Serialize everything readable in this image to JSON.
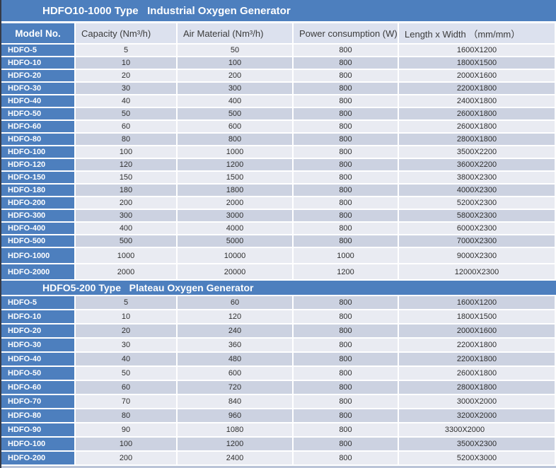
{
  "table": {
    "columns": [
      "Model No.",
      "Capacity (Nm³/h)",
      "Air Material (Nm³/h)",
      "Power consumption (W)",
      "Length x Width （mm/mm）"
    ]
  },
  "sections": [
    {
      "title": "HDFO10-1000 Type   Industrial Oxygen Generator",
      "rows": [
        [
          "HDFO-5",
          "5",
          "50",
          "800",
          "1600X1200"
        ],
        [
          "HDFO-10",
          "10",
          "100",
          "800",
          "1800X1500"
        ],
        [
          "HDFO-20",
          "20",
          "200",
          "800",
          "2000X1600"
        ],
        [
          "HDFO-30",
          "30",
          "300",
          "800",
          "2200X1800"
        ],
        [
          "HDFO-40",
          "40",
          "400",
          "800",
          "2400X1800"
        ],
        [
          "HDFO-50",
          "50",
          "500",
          "800",
          "2600X1800"
        ],
        [
          "HDFO-60",
          "60",
          "600",
          "800",
          "2600X1800"
        ],
        [
          "HDFO-80",
          "80",
          "800",
          "800",
          "2800X1800"
        ],
        [
          "HDFO-100",
          "100",
          "1000",
          "800",
          "3500X2200"
        ],
        [
          "HDFO-120",
          "120",
          "1200",
          "800",
          "3600X2200"
        ],
        [
          "HDFO-150",
          "150",
          "1500",
          "800",
          "3800X2300"
        ],
        [
          "HDFO-180",
          "180",
          "1800",
          "800",
          "4000X2300"
        ],
        [
          "HDFO-200",
          "200",
          "2000",
          "800",
          "5200X2300"
        ],
        [
          "HDFO-300",
          "300",
          "3000",
          "800",
          "5800X2300"
        ],
        [
          "HDFO-400",
          "400",
          "4000",
          "800",
          "6000X2300"
        ],
        [
          "HDFO-500",
          "500",
          "5000",
          "800",
          "7000X2300"
        ],
        [
          "HDFO-1000",
          "1000",
          "10000",
          "1000",
          "9000X2300"
        ],
        [
          "HDFO-2000",
          "2000",
          "20000",
          "1200",
          "12000X2300"
        ]
      ]
    },
    {
      "title": "HDFO5-200 Type   Plateau Oxygen Generator",
      "rows": [
        [
          "HDFO-5",
          "5",
          "60",
          "800",
          "1600X1200"
        ],
        [
          "HDFO-10",
          "10",
          "120",
          "800",
          "1800X1500"
        ],
        [
          "HDFO-20",
          "20",
          "240",
          "800",
          "2000X1600"
        ],
        [
          "HDFO-30",
          "30",
          "360",
          "800",
          "2200X1800"
        ],
        [
          "HDFO-40",
          "40",
          "480",
          "800",
          "2200X1800"
        ],
        [
          "HDFO-50",
          "50",
          "600",
          "800",
          "2600X1800"
        ],
        [
          "HDFO-60",
          "60",
          "720",
          "800",
          "2800X1800"
        ],
        [
          "HDFO-70",
          "70",
          "840",
          "800",
          "3000X2000"
        ],
        [
          "HDFO-80",
          "80",
          "960",
          "800",
          "3200X2000"
        ],
        [
          "HDFO-90",
          "90",
          "1080",
          "800",
          "3300X2000"
        ],
        [
          "HDFO-100",
          "100",
          "1200",
          "800",
          "3500X2300"
        ],
        [
          "HDFO-200",
          "200",
          "2400",
          "800",
          "5200X3000"
        ]
      ]
    }
  ]
}
